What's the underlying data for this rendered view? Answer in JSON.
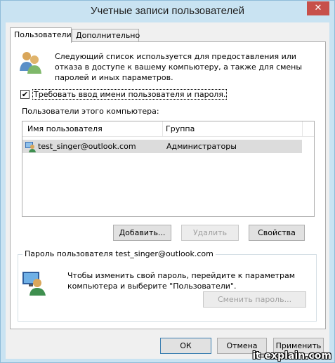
{
  "window": {
    "title": "Учетные записи пользователей",
    "close_label": "✕"
  },
  "tabs": [
    {
      "label": "Пользователи",
      "active": true
    },
    {
      "label": "Дополнительно",
      "active": false
    }
  ],
  "users_tab": {
    "intro_text": "Следующий список используется для предоставления или отказа в доступе к вашему компьютеру, а также для смены паролей и иных параметров.",
    "require_login_checkbox": {
      "label": "Требовать ввод имени пользователя и пароля.",
      "checked": true,
      "mark": "✔"
    },
    "list_label": "Пользователи этого компьютера:",
    "columns": [
      "Имя пользователя",
      "Группа"
    ],
    "rows": [
      {
        "name": "test_singer@outlook.com",
        "group": "Администраторы"
      }
    ],
    "buttons": {
      "add": "Добавить...",
      "remove": "Удалить",
      "properties": "Свойства"
    },
    "password_group": {
      "title": "Пароль пользователя test_singer@outlook.com",
      "text": "Чтобы изменить свой пароль, перейдите к параметрам компьютера и выберите \"Пользователи\".",
      "change_button": "Сменить пароль..."
    }
  },
  "dialog_buttons": {
    "ok": "ОК",
    "cancel": "Отмена",
    "apply": "Применить"
  },
  "watermark": "it-explain.com",
  "colors": {
    "frame": "#c9e3f2",
    "close": "#c7504a",
    "selected_row": "#dcdcdc"
  }
}
